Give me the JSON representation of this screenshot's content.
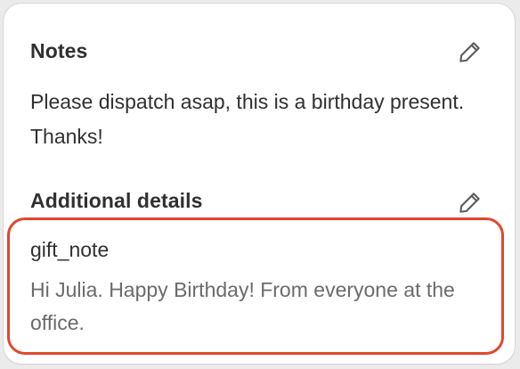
{
  "notes": {
    "title": "Notes",
    "text": "Please dispatch asap, this is a birthday present. Thanks!",
    "edit_icon": "pencil-icon"
  },
  "additional_details": {
    "title": "Additional details",
    "edit_icon": "pencil-icon",
    "attributes": [
      {
        "key": "gift_note",
        "value": "Hi Julia. Happy Birthday! From everyone at the office."
      }
    ]
  },
  "colors": {
    "highlight_border": "#e2472f",
    "text_primary": "#303030",
    "text_secondary": "#6b6b6b"
  }
}
